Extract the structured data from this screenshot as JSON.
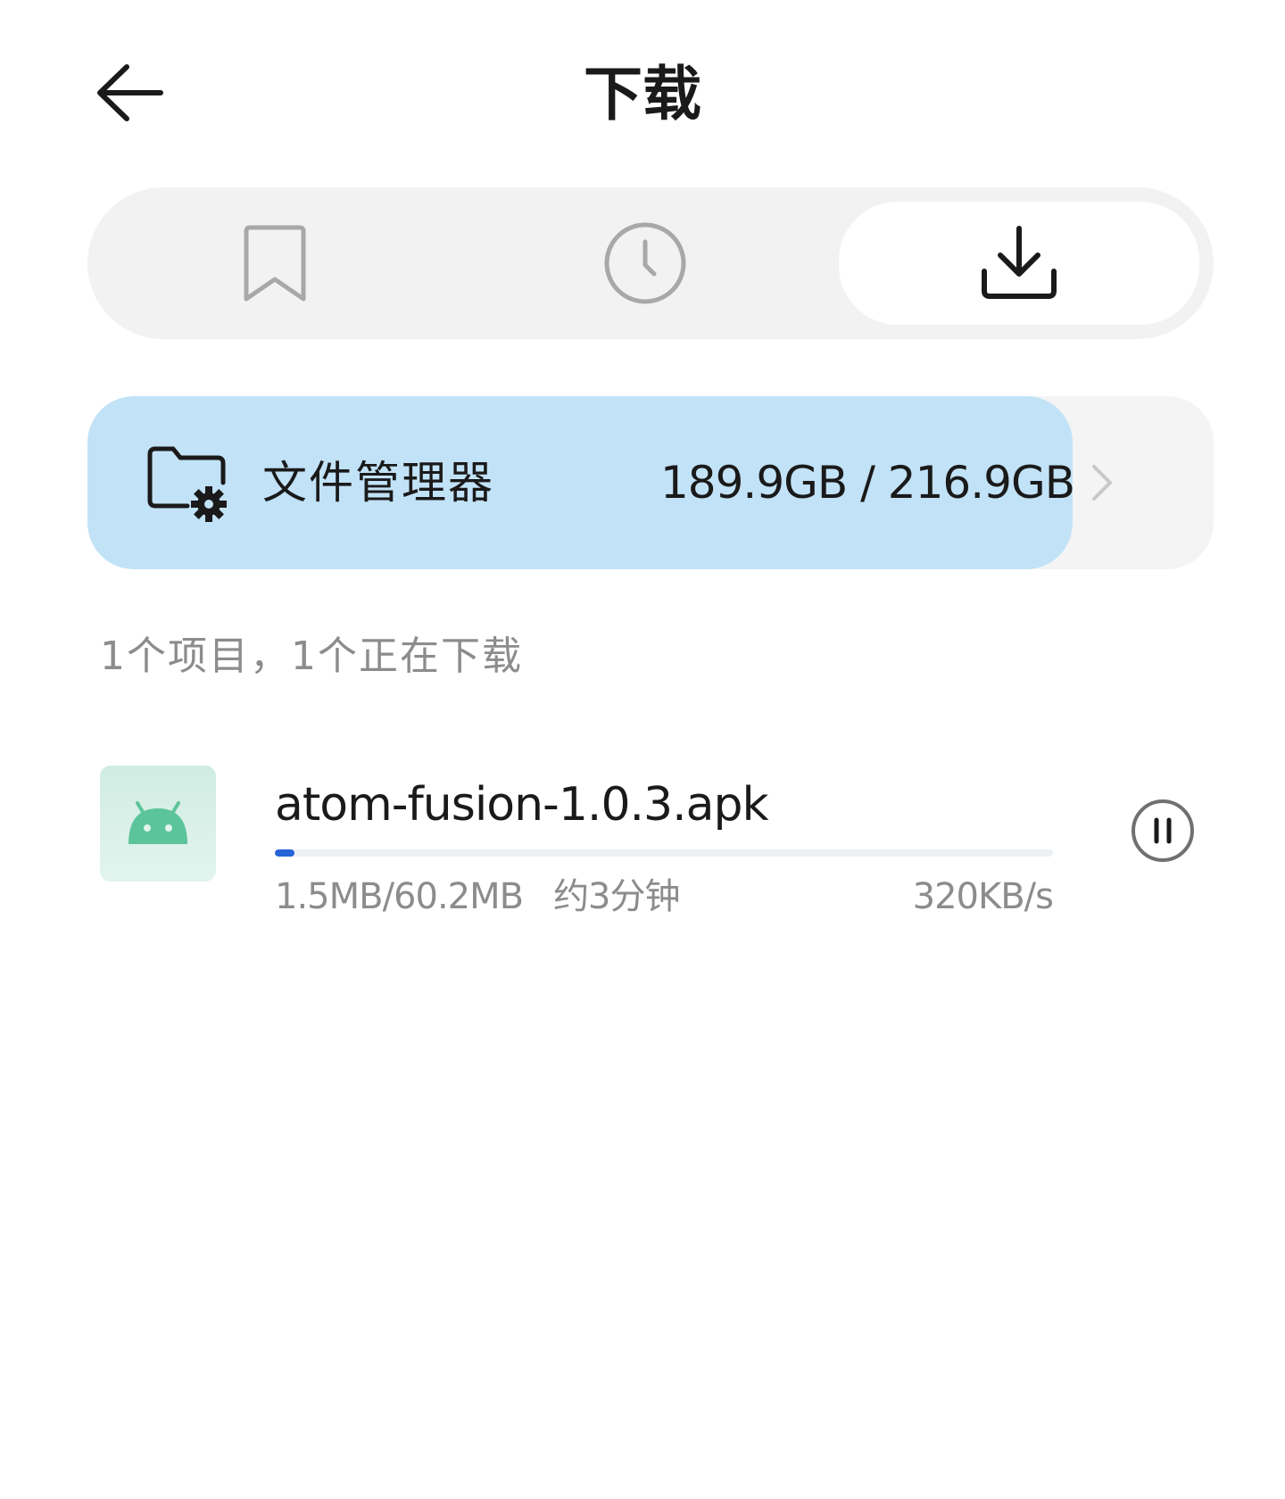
{
  "header": {
    "title": "下载"
  },
  "tabs": [
    {
      "name": "bookmarks",
      "icon": "bookmark-icon",
      "selected": false
    },
    {
      "name": "history",
      "icon": "clock-icon",
      "selected": false
    },
    {
      "name": "downloads",
      "icon": "download-icon",
      "selected": true
    }
  ],
  "storage": {
    "label": "文件管理器",
    "usage": "189.9GB / 216.9GB",
    "used_fraction": 0.875,
    "icon": "folder-settings-icon",
    "fill_color": "#c2e2f7"
  },
  "summary": "1个项目，1个正在下载",
  "downloads": [
    {
      "file_name": "atom-fusion-1.0.3.apk",
      "icon": "android-icon",
      "progress_text": "1.5MB/60.2MB",
      "eta": "约3分钟",
      "speed": "320KB/s",
      "progress_fraction": 0.025,
      "action_icon": "pause-icon"
    }
  ],
  "colors": {
    "accent": "#2563d6",
    "android_green": "#5cc49a",
    "muted_text": "#8c8c8c",
    "icon_gray": "#a8a8a8"
  }
}
